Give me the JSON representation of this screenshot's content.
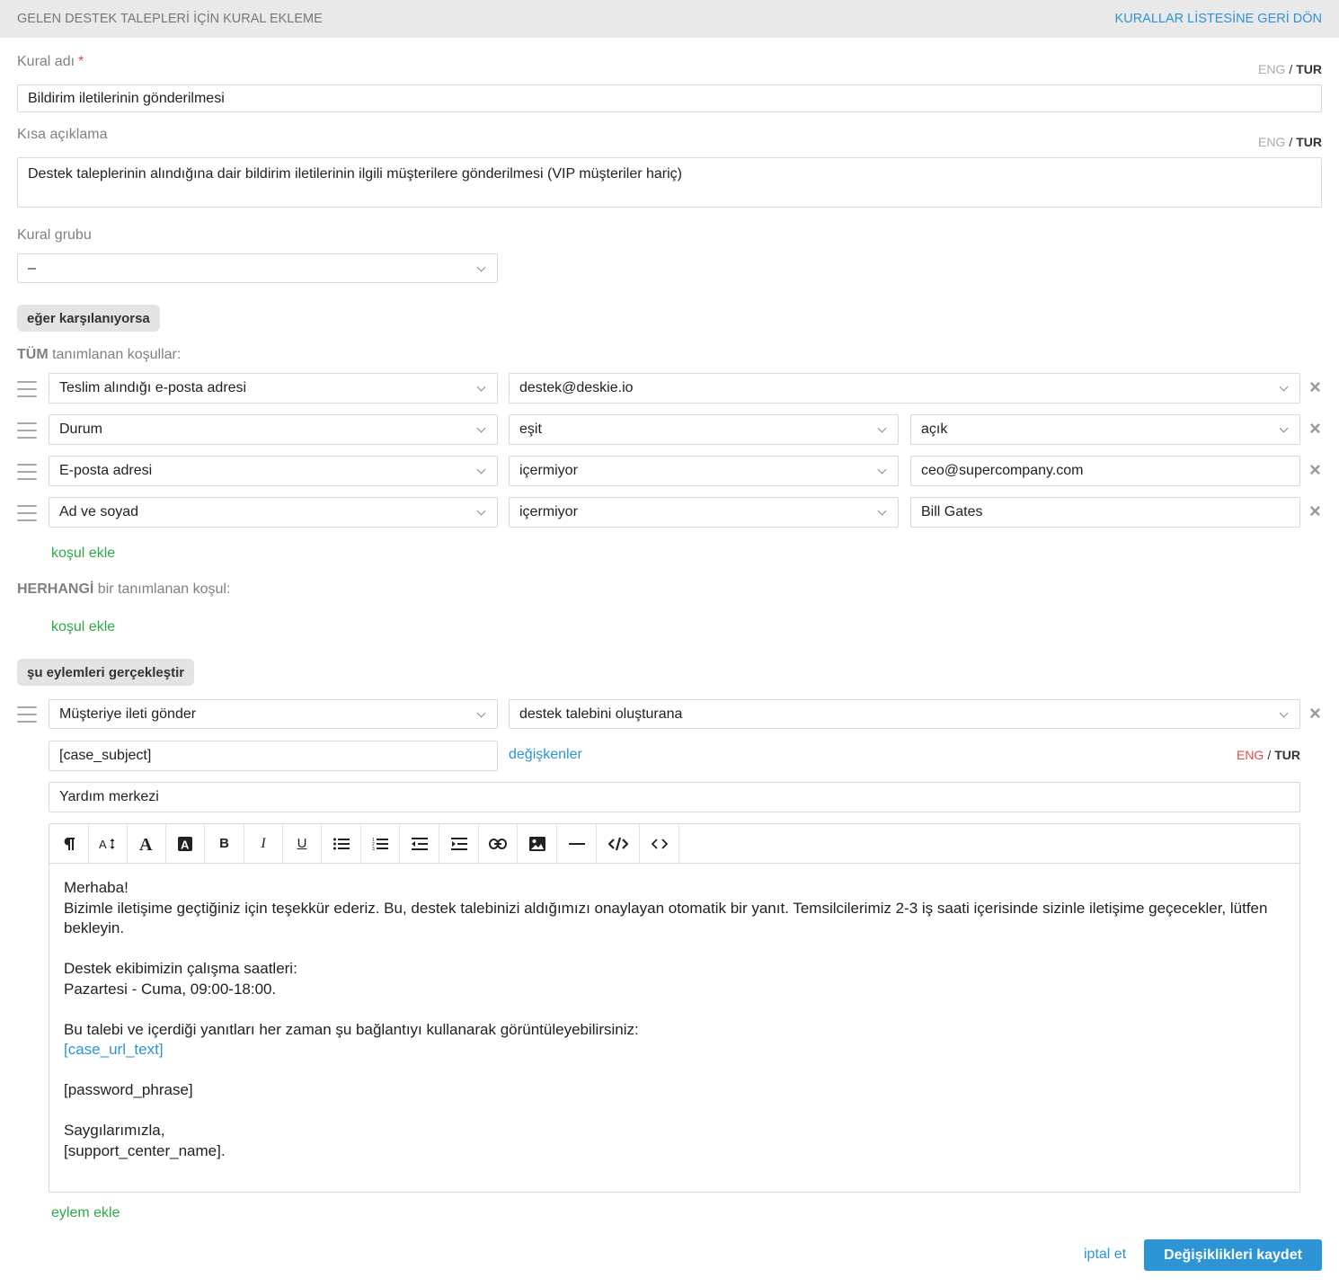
{
  "header": {
    "title": "GELEN DESTEK TALEPLERİ İÇİN KURAL EKLEME",
    "back_link": "KURALLAR LİSTESİNE GERİ DÖN"
  },
  "lang": {
    "eng": "ENG",
    "sep": "/",
    "tur": "TUR"
  },
  "rule_name": {
    "label": "Kural adı",
    "required_mark": "*",
    "value": "Bildirim iletilerinin gönderilmesi"
  },
  "short_desc": {
    "label": "Kısa açıklama",
    "value": "Destek taleplerinin alındığına dair bildirim iletilerinin ilgili müşterilere gönderilmesi (VIP müşteriler hariç)"
  },
  "rule_group": {
    "label": "Kural grubu",
    "value": "–"
  },
  "if_section": {
    "label": "eğer karşılanıyorsa"
  },
  "all_conditions": {
    "prefix": "TÜM",
    "suffix": "tanımlanan koşullar:",
    "rows": [
      {
        "field": "Teslim alındığı e-posta adresi",
        "value": "destek@deskie.io"
      },
      {
        "field": "Durum",
        "operator": "eşit",
        "value": "açık"
      },
      {
        "field": "E-posta adresi",
        "operator": "içermiyor",
        "value": "ceo@supercompany.com"
      },
      {
        "field": "Ad ve soyad",
        "operator": "içermiyor",
        "value": "Bill Gates"
      }
    ],
    "add_link": "koşul ekle"
  },
  "any_conditions": {
    "prefix": "HERHANGİ",
    "suffix": "bir tanımlanan koşul:",
    "add_link": "koşul ekle"
  },
  "actions_section": {
    "label": "şu eylemleri gerçekleştir"
  },
  "action": {
    "type": "Müşteriye ileti gönder",
    "target": "destek talebini oluşturana",
    "subject": "[case_subject]",
    "variables_link": "değişkenler",
    "from_name": "Yardım merkezi",
    "body": {
      "line1": "Merhaba!",
      "line2": "Bizimle iletişime geçtiğiniz için teşekkür ederiz. Bu, destek talebinizi aldığımızı onaylayan otomatik bir yanıt. Temsilcilerimiz 2-3 iş saati içerisinde sizinle iletişime geçecekler, lütfen bekleyin.",
      "line3": "Destek ekibimizin çalışma saatleri:",
      "line4": "Pazartesi - Cuma, 09:00-18:00.",
      "line5": "Bu talebi ve içerdiği yanıtları her zaman şu bağlantıyı kullanarak görüntüleyebilirsiniz:",
      "link": "[case_url_text]",
      "line6": "[password_phrase]",
      "line7": "Saygılarımızla,",
      "line8": "[support_center_name]."
    }
  },
  "add_action_link": "eylem ekle",
  "footer": {
    "cancel": "iptal et",
    "save": "Değişiklikleri kaydet"
  },
  "colors": {
    "accent": "#2d94d6",
    "green": "#2ba84a",
    "required": "#e24646"
  },
  "toolbar_icons": [
    "paragraph-icon",
    "font-size-icon",
    "text-color-icon",
    "background-color-icon",
    "bold-icon",
    "italic-icon",
    "underline-icon",
    "bulleted-list-icon",
    "numbered-list-icon",
    "outdent-icon",
    "indent-icon",
    "link-icon",
    "image-icon",
    "horizontal-rule-icon",
    "code-view-icon",
    "code-inline-icon"
  ]
}
